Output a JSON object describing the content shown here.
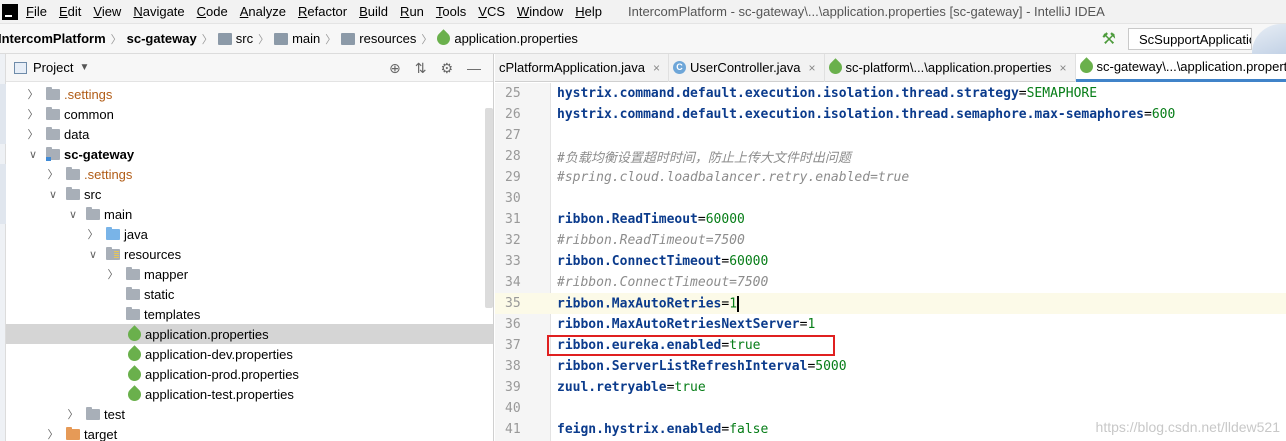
{
  "menu": {
    "items": [
      "File",
      "Edit",
      "View",
      "Navigate",
      "Code",
      "Analyze",
      "Refactor",
      "Build",
      "Run",
      "Tools",
      "VCS",
      "Window",
      "Help"
    ],
    "window_title": "IntercomPlatform - sc-gateway\\...\\application.properties [sc-gateway] - IntelliJ IDEA"
  },
  "breadcrumb": [
    "IntercomPlatform",
    "sc-gateway",
    "src",
    "main",
    "resources",
    "application.properties"
  ],
  "run_config": "ScSupportApplication",
  "project_panel": {
    "title": "Project",
    "tree": [
      {
        "label": ".settings",
        "arrow": "right",
        "icon": "folder",
        "orange": true
      },
      {
        "label": "common",
        "arrow": "right",
        "icon": "folder"
      },
      {
        "label": "data",
        "arrow": "right",
        "icon": "folder"
      },
      {
        "label": "sc-gateway",
        "arrow": "down",
        "icon": "module",
        "bold": true
      },
      {
        "label": ".settings",
        "arrow": "right",
        "icon": "folder",
        "orange": true
      },
      {
        "label": "src",
        "arrow": "down",
        "icon": "folder"
      },
      {
        "label": "main",
        "arrow": "down",
        "icon": "folder"
      },
      {
        "label": "java",
        "arrow": "right",
        "icon": "source"
      },
      {
        "label": "resources",
        "arrow": "down",
        "icon": "resources"
      },
      {
        "label": "mapper",
        "arrow": "right",
        "icon": "folder"
      },
      {
        "label": "static",
        "arrow": "none",
        "icon": "folder"
      },
      {
        "label": "templates",
        "arrow": "none",
        "icon": "folder"
      },
      {
        "label": "application.properties",
        "arrow": "none",
        "icon": "spring",
        "selected": true
      },
      {
        "label": "application-dev.properties",
        "arrow": "none",
        "icon": "spring"
      },
      {
        "label": "application-prod.properties",
        "arrow": "none",
        "icon": "spring"
      },
      {
        "label": "application-test.properties",
        "arrow": "none",
        "icon": "spring"
      },
      {
        "label": "test",
        "arrow": "right",
        "icon": "folder"
      },
      {
        "label": "target",
        "arrow": "right",
        "icon": "excluded"
      }
    ]
  },
  "tabs": [
    {
      "label": "cPlatformApplication.java",
      "icon": "none"
    },
    {
      "label": "UserController.java",
      "icon": "class"
    },
    {
      "label": "sc-platform\\...\\application.properties",
      "icon": "spring"
    },
    {
      "label": "sc-gateway\\...\\application.properties",
      "icon": "spring",
      "active": true
    }
  ],
  "code_lines": [
    {
      "n": "25",
      "key": "hystrix.command.default.execution.isolation.thread.strategy",
      "eq": "=",
      "val": "SEMAPHORE"
    },
    {
      "n": "26",
      "key": "hystrix.command.default.execution.isolation.thread.semaphore.max-semaphores",
      "eq": "=",
      "val": "600"
    },
    {
      "n": "27"
    },
    {
      "n": "28",
      "comment": "#负载均衡设置超时时间，防止上传大文件时出问题"
    },
    {
      "n": "29",
      "comment": "#spring.cloud.loadbalancer.retry.enabled=true"
    },
    {
      "n": "30"
    },
    {
      "n": "31",
      "key": "ribbon.ReadTimeout",
      "eq": "=",
      "val": "60000"
    },
    {
      "n": "32",
      "comment": "#ribbon.ReadTimeout=7500"
    },
    {
      "n": "33",
      "key": "ribbon.ConnectTimeout",
      "eq": "=",
      "val": "60000"
    },
    {
      "n": "34",
      "comment": "#ribbon.ConnectTimeout=7500"
    },
    {
      "n": "35",
      "key": "ribbon.MaxAutoRetries",
      "eq": "=",
      "val": "1",
      "current": true
    },
    {
      "n": "36",
      "key": "ribbon.MaxAutoRetriesNextServer",
      "eq": "=",
      "val": "1"
    },
    {
      "n": "37",
      "key": "ribbon.eureka.enabled",
      "eq": "=",
      "val": "true",
      "boxed": true
    },
    {
      "n": "38",
      "key": "ribbon.ServerListRefreshInterval",
      "eq": "=",
      "val": "5000"
    },
    {
      "n": "39",
      "key": "zuul.retryable",
      "eq": "=",
      "val": "true"
    },
    {
      "n": "40"
    },
    {
      "n": "41",
      "key": "feign.hystrix.enabled",
      "eq": "=",
      "val": "false"
    }
  ],
  "watermark": "https://blog.csdn.net/lldew521"
}
